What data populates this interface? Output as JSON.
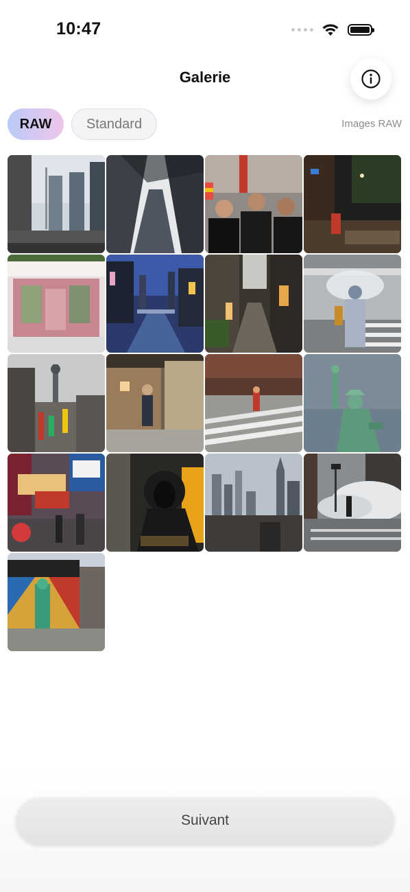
{
  "status_bar": {
    "time": "10:47"
  },
  "header": {
    "title": "Galerie",
    "info_icon": "info-icon"
  },
  "mode_picker": {
    "options": [
      "RAW",
      "Standard"
    ],
    "selected": "RAW",
    "caption": "Images RAW"
  },
  "gallery": {
    "photo_count": 17,
    "photos": [
      "toronto-skyline",
      "skyscraper-looking-up",
      "crowd-parade",
      "night-street-rain",
      "pink-storefront",
      "dotonbori-canal",
      "rainy-alley-lanterns",
      "umbrella-crosswalk",
      "tsutenkaku-tower",
      "man-at-doorway",
      "nyc-crosswalk",
      "statue-of-liberty",
      "times-square",
      "hooded-figure-subway",
      "manhattan-skyline",
      "steam-street",
      "liberty-mural"
    ]
  },
  "footer": {
    "next_label": "Suivant"
  },
  "colors": {
    "accent_gradient_start": "#b8caf7",
    "accent_gradient_end": "#eec6e9",
    "button_bg": "#e6e6e8"
  }
}
